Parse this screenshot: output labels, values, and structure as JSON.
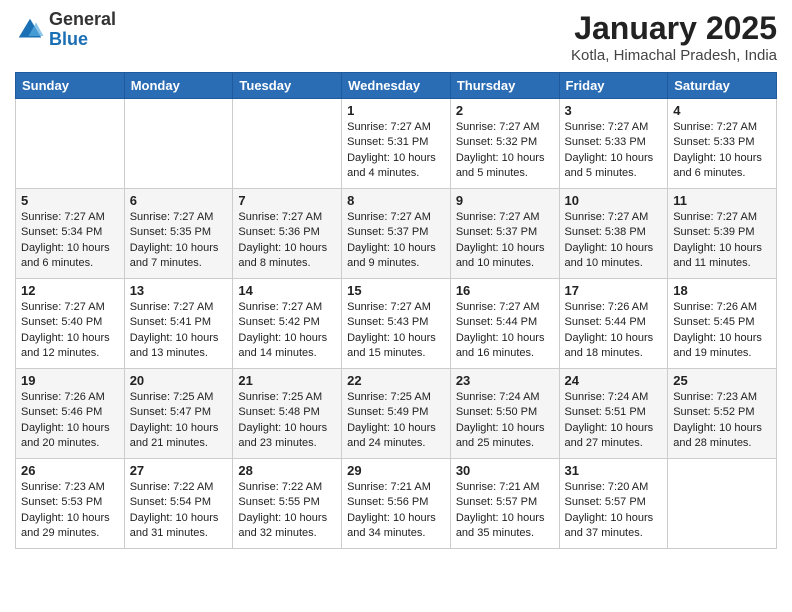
{
  "header": {
    "logo_general": "General",
    "logo_blue": "Blue",
    "month_title": "January 2025",
    "location": "Kotla, Himachal Pradesh, India"
  },
  "days_of_week": [
    "Sunday",
    "Monday",
    "Tuesday",
    "Wednesday",
    "Thursday",
    "Friday",
    "Saturday"
  ],
  "weeks": [
    [
      {
        "day": "",
        "content": ""
      },
      {
        "day": "",
        "content": ""
      },
      {
        "day": "",
        "content": ""
      },
      {
        "day": "1",
        "content": "Sunrise: 7:27 AM\nSunset: 5:31 PM\nDaylight: 10 hours\nand 4 minutes."
      },
      {
        "day": "2",
        "content": "Sunrise: 7:27 AM\nSunset: 5:32 PM\nDaylight: 10 hours\nand 5 minutes."
      },
      {
        "day": "3",
        "content": "Sunrise: 7:27 AM\nSunset: 5:33 PM\nDaylight: 10 hours\nand 5 minutes."
      },
      {
        "day": "4",
        "content": "Sunrise: 7:27 AM\nSunset: 5:33 PM\nDaylight: 10 hours\nand 6 minutes."
      }
    ],
    [
      {
        "day": "5",
        "content": "Sunrise: 7:27 AM\nSunset: 5:34 PM\nDaylight: 10 hours\nand 6 minutes."
      },
      {
        "day": "6",
        "content": "Sunrise: 7:27 AM\nSunset: 5:35 PM\nDaylight: 10 hours\nand 7 minutes."
      },
      {
        "day": "7",
        "content": "Sunrise: 7:27 AM\nSunset: 5:36 PM\nDaylight: 10 hours\nand 8 minutes."
      },
      {
        "day": "8",
        "content": "Sunrise: 7:27 AM\nSunset: 5:37 PM\nDaylight: 10 hours\nand 9 minutes."
      },
      {
        "day": "9",
        "content": "Sunrise: 7:27 AM\nSunset: 5:37 PM\nDaylight: 10 hours\nand 10 minutes."
      },
      {
        "day": "10",
        "content": "Sunrise: 7:27 AM\nSunset: 5:38 PM\nDaylight: 10 hours\nand 10 minutes."
      },
      {
        "day": "11",
        "content": "Sunrise: 7:27 AM\nSunset: 5:39 PM\nDaylight: 10 hours\nand 11 minutes."
      }
    ],
    [
      {
        "day": "12",
        "content": "Sunrise: 7:27 AM\nSunset: 5:40 PM\nDaylight: 10 hours\nand 12 minutes."
      },
      {
        "day": "13",
        "content": "Sunrise: 7:27 AM\nSunset: 5:41 PM\nDaylight: 10 hours\nand 13 minutes."
      },
      {
        "day": "14",
        "content": "Sunrise: 7:27 AM\nSunset: 5:42 PM\nDaylight: 10 hours\nand 14 minutes."
      },
      {
        "day": "15",
        "content": "Sunrise: 7:27 AM\nSunset: 5:43 PM\nDaylight: 10 hours\nand 15 minutes."
      },
      {
        "day": "16",
        "content": "Sunrise: 7:27 AM\nSunset: 5:44 PM\nDaylight: 10 hours\nand 16 minutes."
      },
      {
        "day": "17",
        "content": "Sunrise: 7:26 AM\nSunset: 5:44 PM\nDaylight: 10 hours\nand 18 minutes."
      },
      {
        "day": "18",
        "content": "Sunrise: 7:26 AM\nSunset: 5:45 PM\nDaylight: 10 hours\nand 19 minutes."
      }
    ],
    [
      {
        "day": "19",
        "content": "Sunrise: 7:26 AM\nSunset: 5:46 PM\nDaylight: 10 hours\nand 20 minutes."
      },
      {
        "day": "20",
        "content": "Sunrise: 7:25 AM\nSunset: 5:47 PM\nDaylight: 10 hours\nand 21 minutes."
      },
      {
        "day": "21",
        "content": "Sunrise: 7:25 AM\nSunset: 5:48 PM\nDaylight: 10 hours\nand 23 minutes."
      },
      {
        "day": "22",
        "content": "Sunrise: 7:25 AM\nSunset: 5:49 PM\nDaylight: 10 hours\nand 24 minutes."
      },
      {
        "day": "23",
        "content": "Sunrise: 7:24 AM\nSunset: 5:50 PM\nDaylight: 10 hours\nand 25 minutes."
      },
      {
        "day": "24",
        "content": "Sunrise: 7:24 AM\nSunset: 5:51 PM\nDaylight: 10 hours\nand 27 minutes."
      },
      {
        "day": "25",
        "content": "Sunrise: 7:23 AM\nSunset: 5:52 PM\nDaylight: 10 hours\nand 28 minutes."
      }
    ],
    [
      {
        "day": "26",
        "content": "Sunrise: 7:23 AM\nSunset: 5:53 PM\nDaylight: 10 hours\nand 29 minutes."
      },
      {
        "day": "27",
        "content": "Sunrise: 7:22 AM\nSunset: 5:54 PM\nDaylight: 10 hours\nand 31 minutes."
      },
      {
        "day": "28",
        "content": "Sunrise: 7:22 AM\nSunset: 5:55 PM\nDaylight: 10 hours\nand 32 minutes."
      },
      {
        "day": "29",
        "content": "Sunrise: 7:21 AM\nSunset: 5:56 PM\nDaylight: 10 hours\nand 34 minutes."
      },
      {
        "day": "30",
        "content": "Sunrise: 7:21 AM\nSunset: 5:57 PM\nDaylight: 10 hours\nand 35 minutes."
      },
      {
        "day": "31",
        "content": "Sunrise: 7:20 AM\nSunset: 5:57 PM\nDaylight: 10 hours\nand 37 minutes."
      },
      {
        "day": "",
        "content": ""
      }
    ]
  ]
}
